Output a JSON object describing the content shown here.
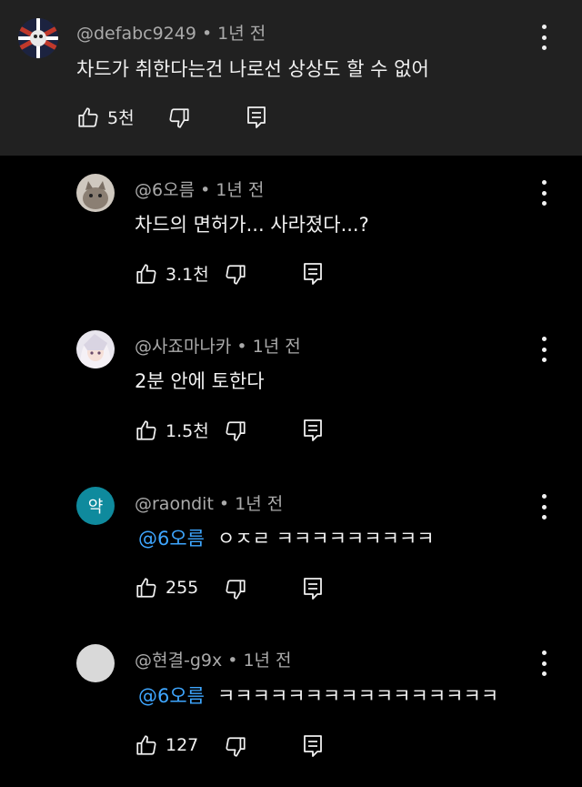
{
  "parent": {
    "author": "@defabc9249",
    "time": "1년 전",
    "text": "차드가 취한다는건 나로선 상상도 할 수 없어",
    "likes": "5천"
  },
  "replies": [
    {
      "author": "@6오름",
      "time": "1년 전",
      "mention": "",
      "text": "차드의 면허가... 사라졌다...?",
      "likes": "3.1천",
      "avatar": "cat-photo"
    },
    {
      "author": "@사죠마나카",
      "time": "1년 전",
      "mention": "",
      "text": "2분 안에 토한다",
      "likes": "1.5천",
      "avatar": "anime-character"
    },
    {
      "author": "@raondit",
      "time": "1년 전",
      "mention": "@6오름",
      "text": "ㅇㅈㄹ ㅋㅋㅋㅋㅋㅋㅋㅋㅋ",
      "likes": "255",
      "avatar_letter": "약",
      "avatar_color": "#0f8a9d"
    },
    {
      "author": "@현결-g9x",
      "time": "1년 전",
      "mention": "@6오름",
      "text": "ㅋㅋㅋㅋㅋㅋㅋㅋㅋㅋㅋㅋㅋㅋㅋㅋ",
      "likes": "127",
      "avatar_color": "#d9d9d9"
    }
  ],
  "icons": {
    "like": "thumbs-up-icon",
    "dislike": "thumbs-down-icon",
    "reply": "reply-icon",
    "more": "more-vertical-icon"
  }
}
